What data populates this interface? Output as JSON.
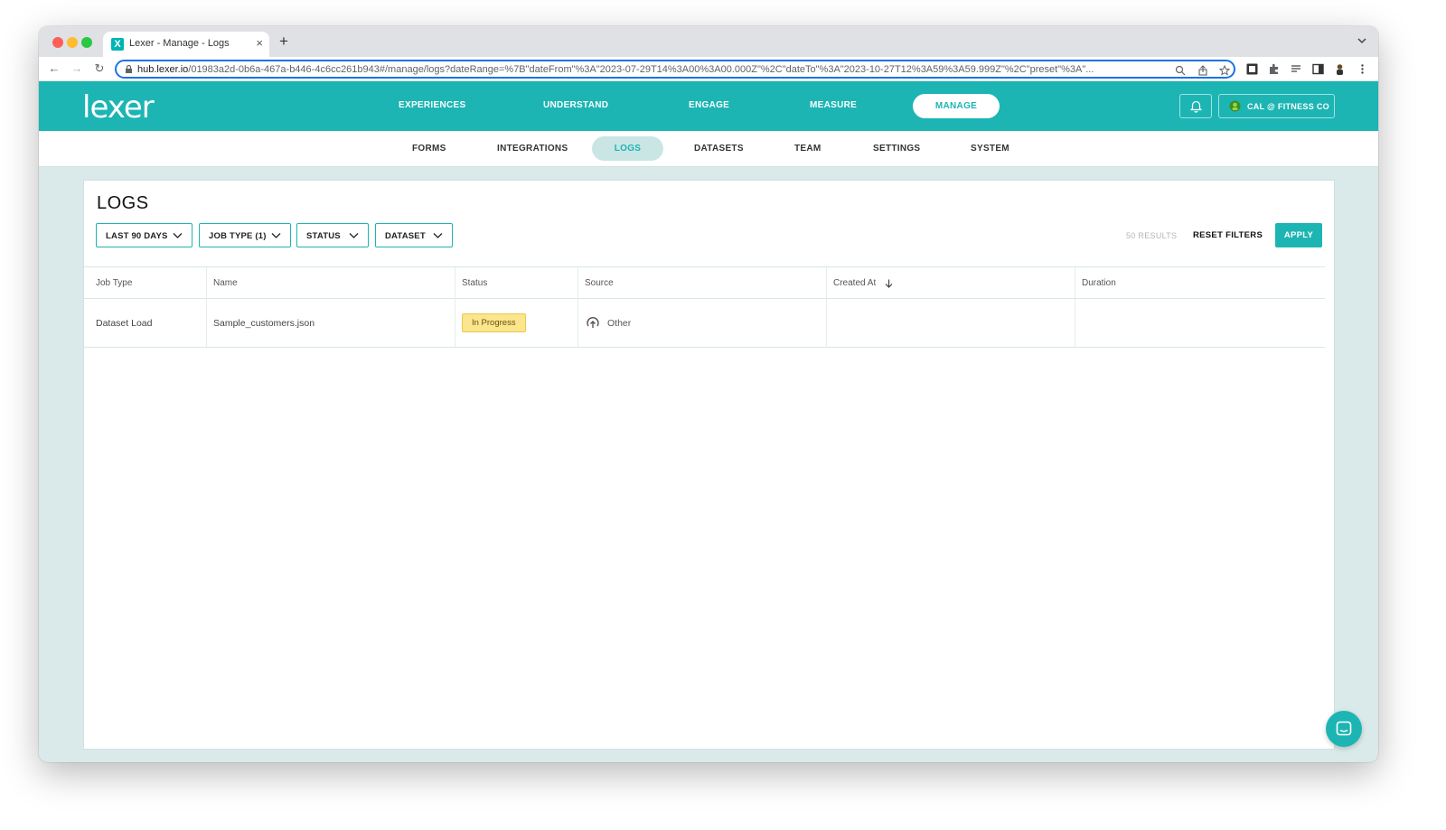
{
  "browser": {
    "tab_title": "Lexer - Manage - Logs",
    "tab_favicon_glyph": "X",
    "tab_close": "×",
    "new_tab": "+",
    "url_host": "hub.lexer.io",
    "url_path": "/01983a2d-0b6a-467a-b446-4c6cc261b943#/manage/logs?dateRange=%7B\"dateFrom\"%3A\"2023-07-29T14%3A00%3A00.000Z\"%2C\"dateTo\"%3A\"2023-10-27T12%3A59%3A59.999Z\"%2C\"preset\"%3A\"...",
    "back_glyph": "←",
    "forward_glyph": "→",
    "reload_glyph": "↻"
  },
  "header": {
    "logo": "lexer",
    "nav": [
      {
        "label": "EXPERIENCES"
      },
      {
        "label": "UNDERSTAND"
      },
      {
        "label": "ENGAGE"
      },
      {
        "label": "MEASURE"
      },
      {
        "label": "MANAGE",
        "active": true
      }
    ],
    "account_label": "CAL @ FITNESS CO"
  },
  "subnav": {
    "items": [
      {
        "label": "FORMS"
      },
      {
        "label": "INTEGRATIONS"
      },
      {
        "label": "LOGS",
        "active": true
      },
      {
        "label": "DATASETS"
      },
      {
        "label": "TEAM"
      },
      {
        "label": "SETTINGS"
      },
      {
        "label": "SYSTEM"
      }
    ]
  },
  "page": {
    "title": "LOGS",
    "filters": [
      {
        "label": "LAST 90 DAYS"
      },
      {
        "label": "JOB TYPE (1)"
      },
      {
        "label": "STATUS"
      },
      {
        "label": "DATASET"
      }
    ],
    "results_count": "50 RESULTS",
    "reset_label": "RESET FILTERS",
    "apply_label": "APPLY"
  },
  "table": {
    "columns": [
      "Job Type",
      "Name",
      "Status",
      "Source",
      "Created At",
      "Duration"
    ],
    "sort_column": "Created At",
    "sort_direction": "descending",
    "rows": [
      {
        "job_type": "Dataset Load",
        "name": "Sample_customers.json",
        "status": "In Progress",
        "source": "Other",
        "created_at": "",
        "duration": ""
      }
    ]
  },
  "colors": {
    "brand": "#1cb5b3",
    "status_in_progress_bg": "#fbe58f",
    "page_bg": "#dae9e9"
  }
}
